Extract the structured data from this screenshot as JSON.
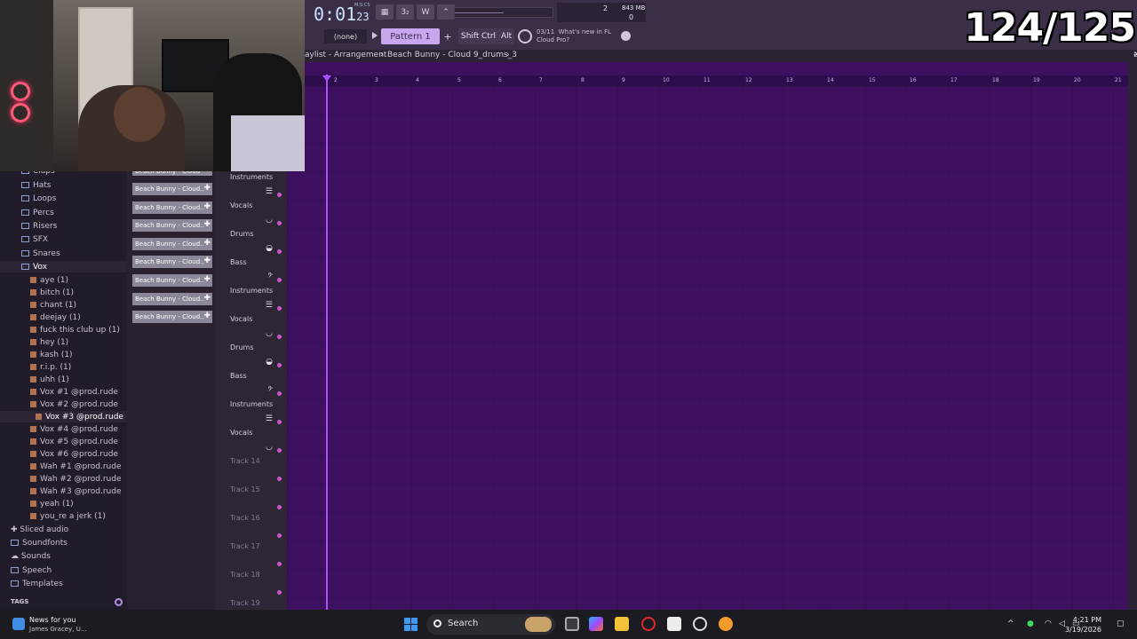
{
  "overlay": {
    "counter": "124/125"
  },
  "toolbar": {
    "time": "0:01",
    "time_small": "23",
    "time_unit": "M:S:CS",
    "buttons": [
      "▦",
      "3₂",
      "W",
      "⌃"
    ],
    "cpu_top": "2",
    "cpu_mem": "843 MB",
    "cpu_bottom": "0",
    "snap": "(none)",
    "pattern": "Pattern 1",
    "add": "+",
    "keys": [
      "Shift",
      "Ctrl",
      "Alt"
    ],
    "news_date": "03/11",
    "news_text": "What's new in FL Cloud Pro?"
  },
  "playlist": {
    "crumbs": [
      "aylist - Arrangement",
      "›",
      "Beach Bunny - Cloud 9_drums_3",
      "›"
    ],
    "ruler": [
      "2",
      "3",
      "4",
      "5",
      "6",
      "7",
      "8",
      "9",
      "10",
      "11",
      "12",
      "13",
      "14",
      "15",
      "16",
      "17",
      "18",
      "19",
      "20",
      "21"
    ]
  },
  "browser": {
    "folders": [
      {
        "label": "Claps"
      },
      {
        "label": "Hats"
      },
      {
        "label": "Loops"
      },
      {
        "label": "Percs"
      },
      {
        "label": "Risers"
      },
      {
        "label": "SFX"
      },
      {
        "label": "Snares"
      },
      {
        "label": "Vox"
      }
    ],
    "files": [
      "aye (1)",
      "bitch (1)",
      "chant (1)",
      "deejay (1)",
      "fuck this club up (1)",
      "hey (1)",
      "kash (1)",
      "r.i.p. (1)",
      "uhh (1)",
      "Vox #1 @prod.rude",
      "Vox #2 @prod.rude",
      "Vox #3 @prod.rude",
      "Vox #4 @prod.rude",
      "Vox #5 @prod.rude",
      "Vox #6 @prod.rude",
      "Wah #1 @prod.rude",
      "Wah #2 @prod.rude",
      "Wah #3 @prod.rude",
      "yeah (1)",
      "you_re a jerk (1)"
    ],
    "roots": [
      "Sliced audio",
      "Soundfonts",
      "Sounds",
      "Speech",
      "Templates"
    ],
    "tags": "TAGS"
  },
  "clips": {
    "top": "Beach Bunny - Cloud",
    "items": [
      "Beach Bunny - Cloud..",
      "Beach Bunny - Cloud..",
      "Beach Bunny - Cloud..",
      "Beach Bunny - Cloud..",
      "Beach Bunny - Cloud..",
      "Beach Bunny - Cloud..",
      "Beach Bunny - Cloud..",
      "Beach Bunny - Cloud.."
    ]
  },
  "tracks": [
    {
      "label": "Instruments",
      "icon": "☰"
    },
    {
      "label": "Vocals",
      "icon": "◡"
    },
    {
      "label": "Drums",
      "icon": "◒"
    },
    {
      "label": "Bass",
      "icon": "𝄢"
    },
    {
      "label": "Instruments",
      "icon": "☰"
    },
    {
      "label": "Vocals",
      "icon": "◡"
    },
    {
      "label": "Drums",
      "icon": "◒"
    },
    {
      "label": "Bass",
      "icon": "𝄢"
    },
    {
      "label": "Instruments",
      "icon": "☰"
    },
    {
      "label": "Vocals",
      "icon": "◡"
    },
    {
      "label": "Track 14",
      "icon": ""
    },
    {
      "label": "Track 15",
      "icon": ""
    },
    {
      "label": "Track 16",
      "icon": ""
    },
    {
      "label": "Track 17",
      "icon": ""
    },
    {
      "label": "Track 18",
      "icon": ""
    },
    {
      "label": "Track 19",
      "icon": ""
    }
  ],
  "taskbar": {
    "news_title": "News for you",
    "news_sub": "James Gracey, U...",
    "search": "Search",
    "time": "4:21 PM",
    "date": "3/19/2026"
  }
}
